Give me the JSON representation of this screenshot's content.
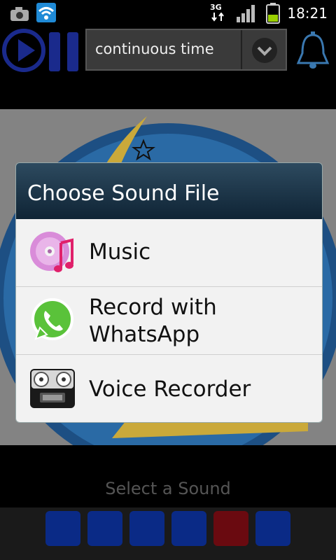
{
  "status_bar": {
    "network_label": "3G",
    "time": "18:21",
    "icons": [
      "camera-icon",
      "wifi-icon",
      "3g-icon",
      "signal-icon",
      "battery-icon"
    ]
  },
  "app_bar": {
    "dropdown_value": "continuous time",
    "icons": [
      "play-icon",
      "pause-icon",
      "chevron-down-icon",
      "bell-icon"
    ]
  },
  "dialog": {
    "title": "Choose Sound File",
    "items": [
      {
        "label": "Music",
        "icon": "music-icon"
      },
      {
        "label": "Record with WhatsApp",
        "label_line1": "Record with",
        "label_line2": "WhatsApp",
        "icon": "whatsapp-icon"
      },
      {
        "label": "Voice Recorder",
        "icon": "voice-recorder-icon"
      }
    ]
  },
  "footer": {
    "prompt": "Select a Sound",
    "slot_colors": [
      "#0a2a86",
      "#0a2a86",
      "#0a2a86",
      "#0a2a86",
      "#6a0a10",
      "#0a2a86"
    ]
  }
}
